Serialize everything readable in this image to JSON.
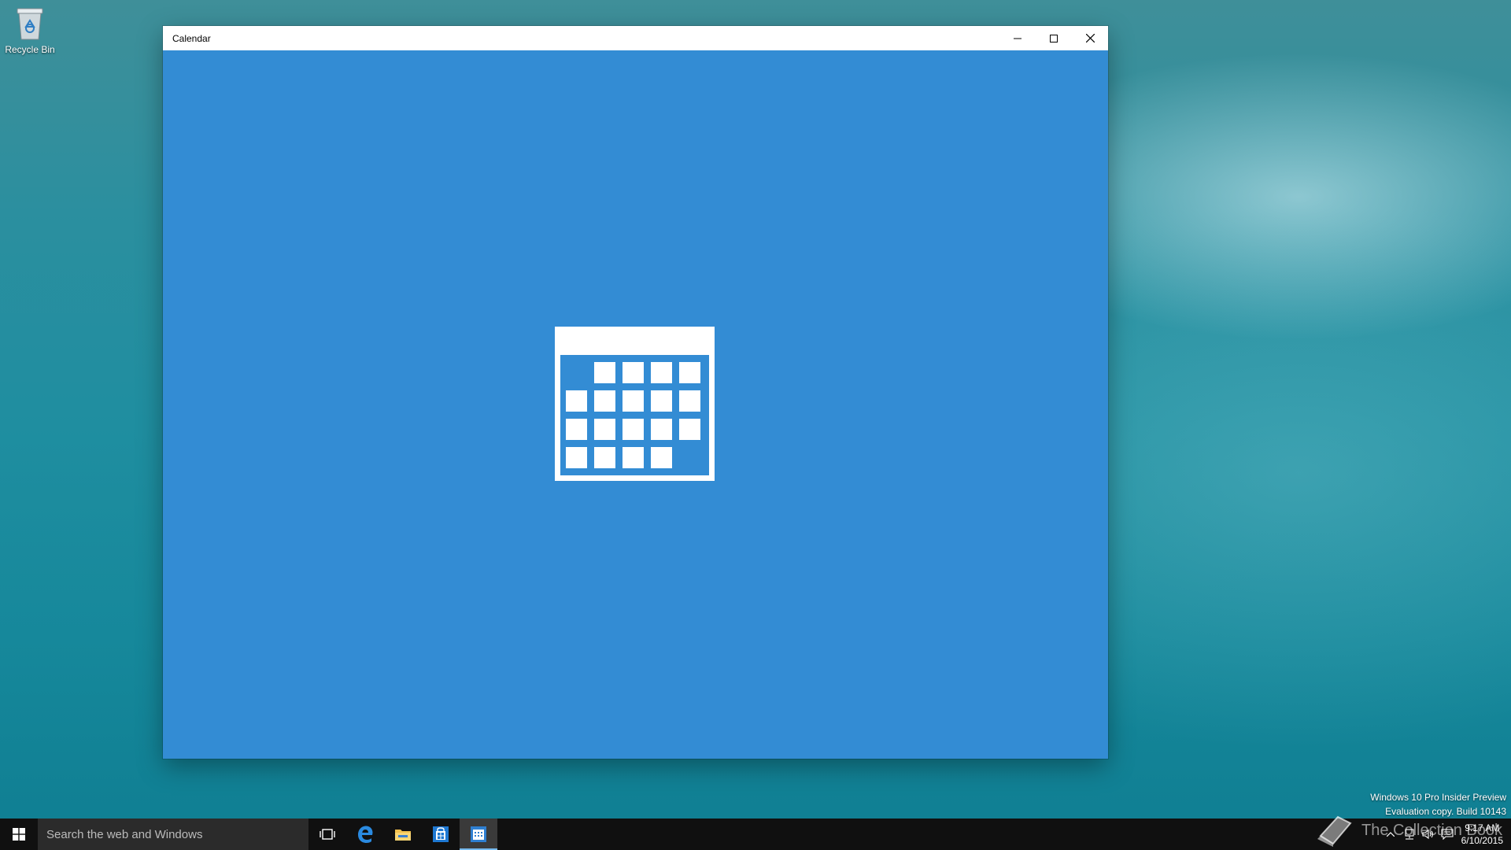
{
  "desktop": {
    "icons": [
      {
        "label": "Recycle Bin",
        "icon": "recycle-bin-icon"
      }
    ]
  },
  "window": {
    "title": "Calendar",
    "controls": [
      "minimize-icon",
      "maximize-icon",
      "close-icon"
    ],
    "background_color": "#338cd4",
    "splash_icon": "calendar-icon"
  },
  "taskbar": {
    "search_placeholder": "Search the web and Windows",
    "apps": [
      {
        "name": "Task View",
        "icon": "task-view-icon"
      },
      {
        "name": "Microsoft Edge",
        "icon": "edge-icon"
      },
      {
        "name": "File Explorer",
        "icon": "folder-icon"
      },
      {
        "name": "Store",
        "icon": "store-icon"
      },
      {
        "name": "Calendar",
        "icon": "calendar-app-icon",
        "active": true
      }
    ],
    "clock": {
      "time": "9:17 AM",
      "date": "6/10/2015"
    }
  },
  "watermark": {
    "line1": "Windows 10 Pro Insider Preview",
    "line2": "Evaluation copy. Build 10143"
  },
  "overlay_brand": "The Collection Book"
}
